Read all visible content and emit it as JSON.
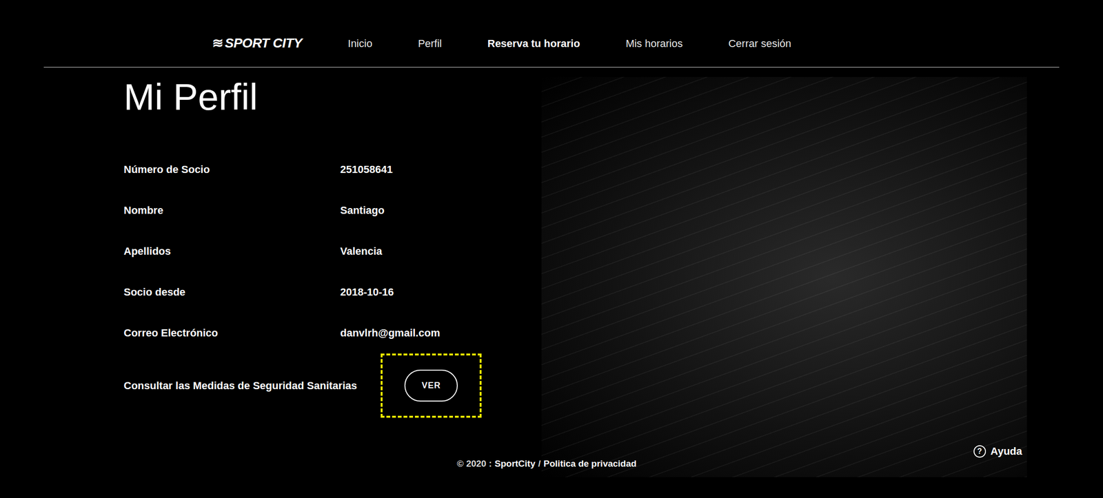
{
  "logo": {
    "mark": "≋",
    "text": "SPORT CITY"
  },
  "nav": [
    {
      "label": "Inicio",
      "selected": false
    },
    {
      "label": "Perfil",
      "selected": false
    },
    {
      "label": "Reserva tu horario",
      "selected": true
    },
    {
      "label": "Mis horarios",
      "selected": false
    },
    {
      "label": "Cerrar sesión",
      "selected": false
    }
  ],
  "title": "Mi Perfil",
  "profile": {
    "rows": [
      {
        "label": "Número de Socio",
        "value": "251058641"
      },
      {
        "label": "Nombre",
        "value": "Santiago"
      },
      {
        "label": "Apellidos",
        "value": "Valencia"
      },
      {
        "label": "Socio desde",
        "value": "2018-10-16"
      },
      {
        "label": "Correo Electrónico",
        "value": "danvlrh@gmail.com"
      }
    ]
  },
  "safety": {
    "label": "Consultar las Medidas de Seguridad Sanitarias",
    "button": "VER",
    "highlighted": true
  },
  "footer": {
    "prefix": "© 2020 :",
    "brand": "SportCity",
    "separator": "/",
    "privacy": "Politica de privacidad"
  },
  "help": {
    "icon": "?",
    "label": "Ayuda"
  }
}
